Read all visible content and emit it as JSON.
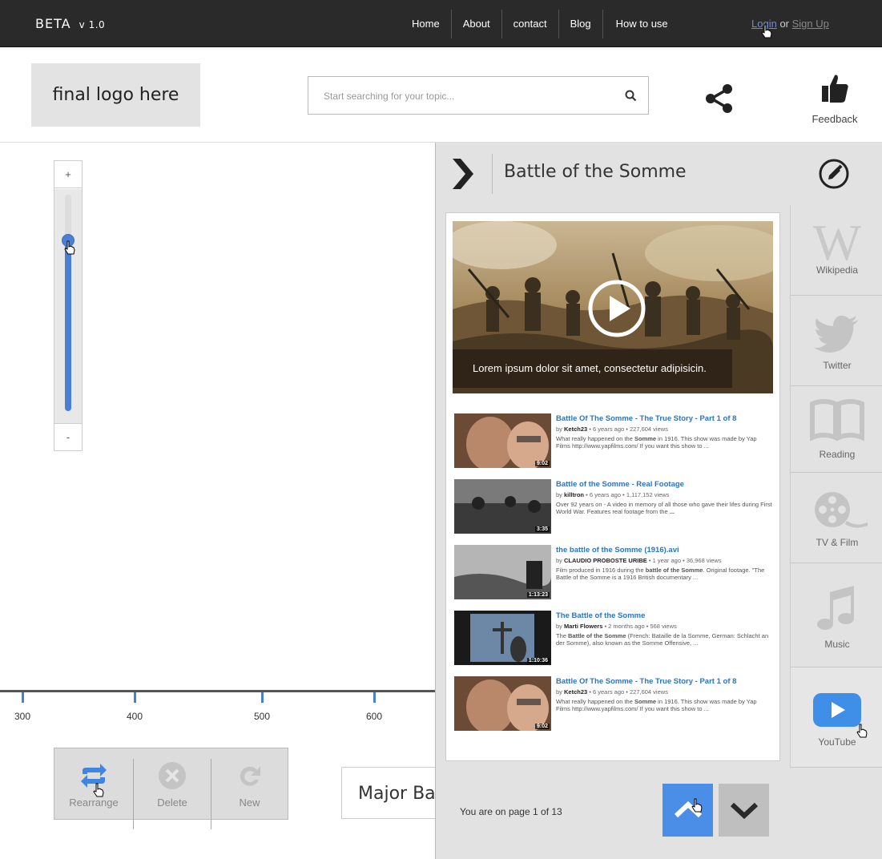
{
  "topbar": {
    "brand": "BETA",
    "version": "v 1.0",
    "nav": [
      "Home",
      "About",
      "contact",
      "Blog",
      "How to use"
    ],
    "login": "Login",
    "or": "or",
    "signup": "Sign Up"
  },
  "header": {
    "logo_text": "final logo here",
    "search_placeholder": "Start searching for your topic...",
    "feedback_label": "Feedback"
  },
  "zoom": {
    "plus": "+",
    "minus": "-",
    "level": 0.79
  },
  "timeline": {
    "ticks": [
      "300",
      "400",
      "500",
      "600"
    ]
  },
  "toolbar": {
    "rearrange": "Rearrange",
    "delete": "Delete",
    "new": "New"
  },
  "major_card": "Major Battles",
  "panel": {
    "title": "Battle of the Somme",
    "video_caption": "Lorem ipsum dolor sit amet, consectetur adipisicin.",
    "results": [
      {
        "title": "Battle Of The Somme - The True Story - Part 1 of 8",
        "by": "by",
        "author": "Ketch23",
        "meta": "• 6 years ago • 227,604 views",
        "desc_a": "What really happened on the ",
        "desc_b": "Somme",
        "desc_c": " in 1916. This show was made by Yap Films http://www.yapfilms.com/ If you want this show to ...",
        "duration": "9:02"
      },
      {
        "title": "Battle of the Somme - Real Footage",
        "by": "by",
        "author": "killtron",
        "meta": "• 6 years ago • 1,117,152 views",
        "desc_a": "Over 92 years on - A video in memory of all those who gave their lifes during First World War. Features real footage from the ",
        "desc_b": "...",
        "desc_c": "",
        "duration": "3:35"
      },
      {
        "title": "the battle of the Somme (1916).avi",
        "by": "by",
        "author": "CLAUDIO PROBOSTE URIBE",
        "meta": "• 1 year ago • 36,968 views",
        "desc_a": "Film produced in 1916 during the ",
        "desc_b": "battle of the Somme",
        "desc_c": ". Original footage. \"The Battle of the Somme is a 1916 British documentary ...",
        "duration": "1:13:23"
      },
      {
        "title": "The Battle of the Somme",
        "by": "by",
        "author": "Marti Flowers",
        "meta": "• 2 months ago • 568 views",
        "desc_a": "The ",
        "desc_b": "Battle of the Somme",
        "desc_c": " (French: Bataille de la Somme, German: Schlacht an der Somme), also known as the Somme Offensive, ...",
        "duration": "1:10:36"
      },
      {
        "title": "Battle Of The Somme - The True Story - Part 1 of 8",
        "by": "by",
        "author": "Ketch23",
        "meta": "• 6 years ago • 227,604 views",
        "desc_a": "What really happened on the ",
        "desc_b": "Somme",
        "desc_c": " in 1916. This show was made by Yap Films http://www.yapfilms.com/ If you want this show to ...",
        "duration": "9:02"
      }
    ],
    "sources": [
      "Wikipedia",
      "Twitter",
      "Reading",
      "TV & Film",
      "Music",
      "YouTube"
    ],
    "pager": {
      "prefix": "You are on page",
      "current": "1",
      "of": "of",
      "total": "13"
    }
  },
  "colors": {
    "accent": "#4a8ee8",
    "topbar": "#2a2a2a",
    "link": "#2b74c6"
  }
}
